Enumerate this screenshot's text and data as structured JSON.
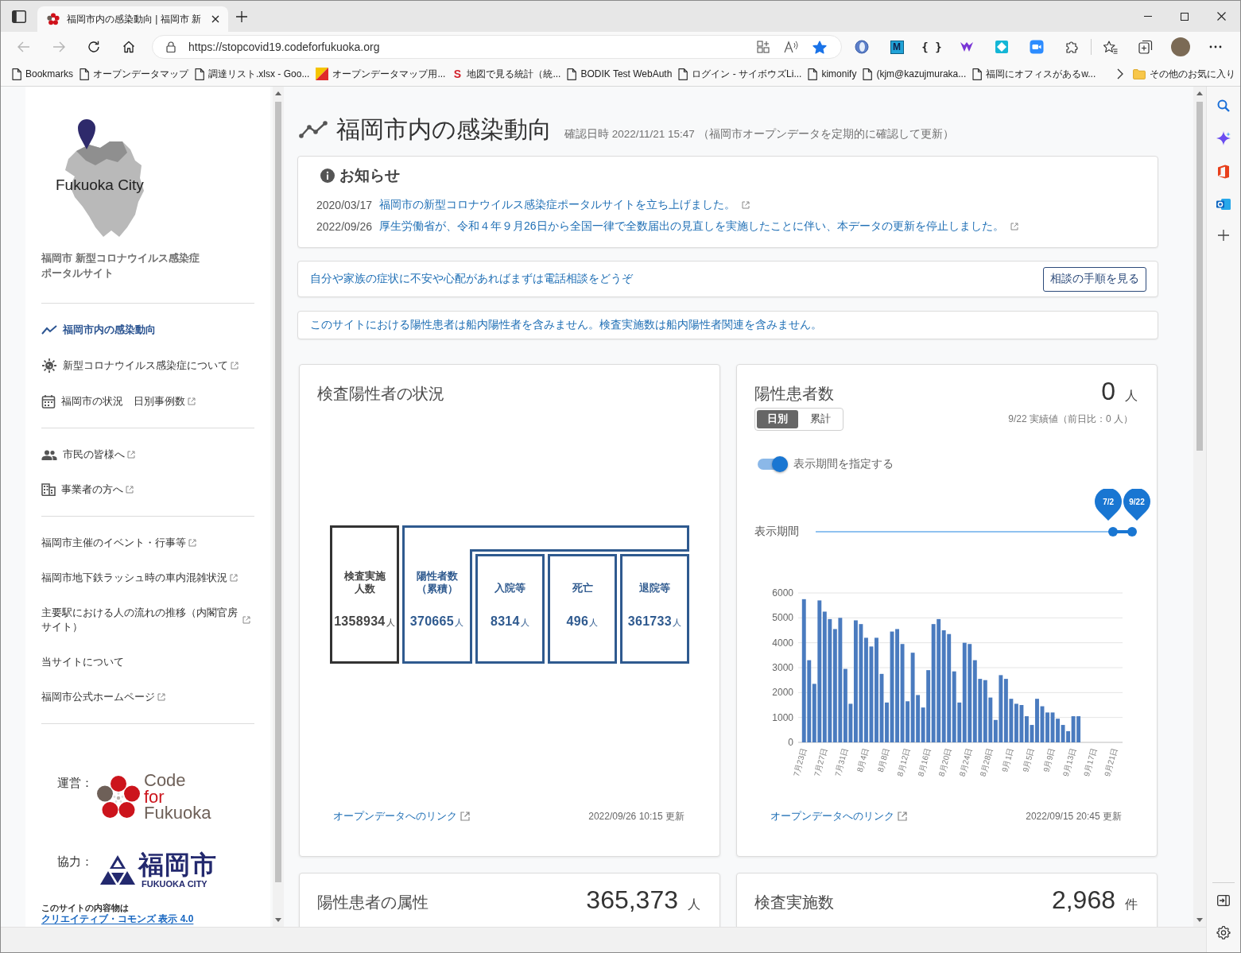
{
  "browser": {
    "tabs": [
      {
        "title": "福岡市内の感染動向 | 福岡市 新",
        "selected": true
      }
    ],
    "nav": {
      "back_disabled": true,
      "forward_disabled": true
    },
    "address": {
      "url": "https://stopcovid19.codeforfukuoka.org",
      "favorited": true
    },
    "extensions": [
      {
        "kind": "orb"
      },
      {
        "kind": "tile",
        "text": "M"
      },
      {
        "kind": "glyph",
        "text": "{ }"
      },
      {
        "kind": "vee"
      },
      {
        "kind": "diamond"
      },
      {
        "kind": "camera"
      }
    ],
    "bookmarks": [
      {
        "kind": "page",
        "label": "Bookmarks"
      },
      {
        "kind": "page",
        "label": "オープンデータマップ"
      },
      {
        "kind": "page",
        "label": "調達リスト.xlsx - Goo..."
      },
      {
        "kind": "flag",
        "label": "オープンデータマップ用..."
      },
      {
        "kind": "letter",
        "icon_text": "S",
        "label": "地図で見る統計（統..."
      },
      {
        "kind": "page",
        "label": "BODIK Test WebAuth"
      },
      {
        "kind": "page",
        "label": "ログイン - サイボウズLi..."
      },
      {
        "kind": "page",
        "label": "kimonify"
      },
      {
        "kind": "page",
        "label": "(kjm@kazujmuraka..."
      },
      {
        "kind": "page",
        "label": "福岡にオフィスがあるw..."
      }
    ],
    "other_bookmarks": "その他のお気に入り"
  },
  "sidebar": {
    "logo_text": "Fukuoka City",
    "subtitle": "福岡市 新型コロナウイルス感染症ポータルサイト",
    "nav_groups": [
      {
        "items": [
          {
            "kind": "trend",
            "label": "福岡市内の感染動向",
            "external": false,
            "selected": true
          },
          {
            "kind": "virus",
            "label": "新型コロナウイルス感染症について",
            "external": true,
            "selected": false
          },
          {
            "kind": "calendar",
            "label": "福岡市の状況　日別事例数",
            "external": true,
            "selected": false
          }
        ]
      },
      {
        "items": [
          {
            "kind": "people",
            "label": "市民の皆様へ",
            "external": true,
            "selected": false
          },
          {
            "kind": "building",
            "label": "事業者の方へ",
            "external": true,
            "selected": false
          }
        ]
      },
      {
        "items": [
          {
            "kind": "plain",
            "label": "福岡市主催のイベント・行事等",
            "external": true,
            "selected": false
          },
          {
            "kind": "plain",
            "label": "福岡市地下鉄ラッシュ時の車内混雑状況",
            "external": true,
            "selected": false
          },
          {
            "kind": "plain",
            "label": "主要駅における人の流れの推移（内閣官房サイト）",
            "external": true,
            "selected": false
          },
          {
            "kind": "plain",
            "label": "当サイトについて",
            "external": false,
            "selected": false
          },
          {
            "kind": "plain",
            "label": "福岡市公式ホームページ",
            "external": true,
            "selected": false
          }
        ]
      }
    ],
    "operator": {
      "label": "運営：",
      "wordmark": [
        "Code",
        "for",
        "Fukuoka"
      ]
    },
    "partner": {
      "label": "協力：",
      "name": "福岡市",
      "name_en": "FUKUOKA CITY"
    },
    "license": {
      "text": "このサイトの内容物は",
      "link": "クリエイティブ・コモンズ 表示 4.0"
    }
  },
  "main": {
    "header": {
      "title": "福岡市内の感染動向",
      "checked_at": "確認日時 2022/11/21 15:47 （福岡市オープンデータを定期的に確認して更新）"
    },
    "notices": {
      "title": "お知らせ",
      "items": [
        {
          "date": "2020/03/17",
          "text": "福岡市の新型コロナウイルス感染症ポータルサイトを立ち上げました。"
        },
        {
          "date": "2022/09/26",
          "text": "厚生労働省が、令和４年９月26日から全国一律で全数届出の見直しを実施したことに伴い、本データの更新を停止しました。"
        }
      ]
    },
    "consult": {
      "text": "自分や家族の症状に不安や心配があればまずは電話相談をどうぞ",
      "button": "相談の手順を見る"
    },
    "disclaimer": "このサイトにおける陽性患者は船内陽性者を含みません。検査実施数は船内陽性者関連を含みません。",
    "cards": [
      {
        "kind": "diagram",
        "title": "検査陽性者の状況",
        "diagram": {
          "total": {
            "label": "検査実施人数",
            "value": "1358934",
            "unit": "人"
          },
          "positive": {
            "label": "陽性者数（累積）",
            "value": "370665",
            "unit": "人",
            "children": [
              {
                "label": "入院等",
                "value": "8314",
                "unit": "人"
              },
              {
                "label": "死亡",
                "value": "496",
                "unit": "人"
              },
              {
                "label": "退院等",
                "value": "361733",
                "unit": "人"
              }
            ]
          }
        },
        "link": "オープンデータへのリンク",
        "updated": "2022/09/26 10:15 更新"
      },
      {
        "kind": "chart",
        "title": "陽性患者数",
        "total": "0",
        "unit": "人",
        "modes": [
          {
            "label": "日別",
            "selected": true
          },
          {
            "label": "累計",
            "selected": false
          }
        ],
        "note": "9/22 実績値（前日比：0 人）",
        "period_switch": {
          "label": "表示期間を指定する",
          "on": true
        },
        "period_slider": {
          "label": "表示期間",
          "handles": [
            {
              "label": "7/2",
              "level": 0.94
            },
            {
              "label": "9/22",
              "level": 1
            }
          ]
        },
        "chart_data": {
          "type": "bar",
          "categories": [
            "7月23日",
            null,
            null,
            null,
            "7月27日",
            null,
            null,
            null,
            "7月31日",
            null,
            null,
            null,
            "8月4日",
            null,
            null,
            null,
            "8月8日",
            null,
            null,
            null,
            "8月12日",
            null,
            null,
            null,
            "8月16日",
            null,
            null,
            null,
            "8月20日",
            null,
            null,
            null,
            "8月24日",
            null,
            null,
            null,
            "8月28日",
            null,
            null,
            null,
            "9月1日",
            null,
            null,
            null,
            "9月5日",
            null,
            null,
            null,
            "9月9日",
            null,
            null,
            null,
            "9月13日",
            null,
            null,
            null,
            "9月17日",
            null,
            null,
            null,
            "9月21日",
            null
          ],
          "values": [
            5750,
            3300,
            2350,
            5700,
            5250,
            4950,
            4550,
            5000,
            2950,
            1550,
            4900,
            4750,
            4200,
            3850,
            4200,
            2750,
            1600,
            4450,
            4550,
            3950,
            1650,
            3600,
            1900,
            1400,
            2900,
            4750,
            4950,
            4500,
            4350,
            2850,
            1600,
            4000,
            3950,
            3300,
            2550,
            2500,
            1800,
            900,
            2700,
            2550,
            1750,
            1550,
            1500,
            1050,
            700,
            1750,
            1450,
            1200,
            1200,
            950,
            700,
            450,
            1050,
            1050,
            0,
            0,
            0,
            0,
            0,
            0,
            0,
            0
          ],
          "ylim": [
            0,
            6000
          ],
          "yticks": [
            0,
            1000,
            2000,
            3000,
            4000,
            5000,
            6000
          ],
          "grid": true
        },
        "link": "オープンデータへのリンク",
        "updated": "2022/09/15 20:45 更新"
      },
      {
        "kind": "summary",
        "title": "陽性患者の属性",
        "total": "365,373",
        "unit": "人"
      },
      {
        "kind": "summary",
        "title": "検査実施数",
        "total": "2,968",
        "unit": "件"
      }
    ]
  }
}
